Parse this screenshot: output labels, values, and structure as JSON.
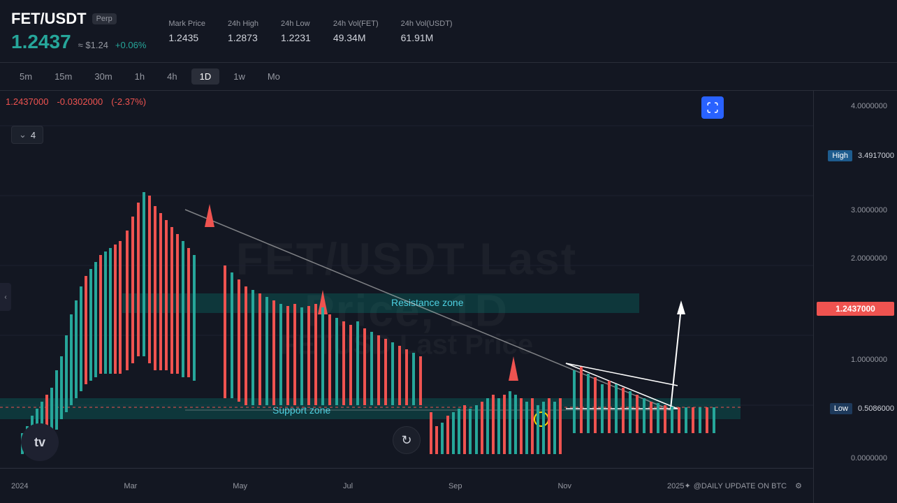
{
  "header": {
    "pair_symbol": "FET/USDT",
    "pair_type": "Perp",
    "price": "1.2437",
    "price_usd": "≈ $1.24",
    "price_change": "+0.06%",
    "mark_price_label": "Mark Price",
    "mark_price_value": "1.2435",
    "high_label": "24h High",
    "high_value": "1.2873",
    "low_label": "24h Low",
    "low_value": "1.2231",
    "vol_fet_label": "24h Vol(FET)",
    "vol_fet_value": "49.34M",
    "vol_usdt_label": "24h Vol(USDT)",
    "vol_usdt_value": "61.91M"
  },
  "timeframes": [
    "5m",
    "15m",
    "30m",
    "1h",
    "4h",
    "1D",
    "1w",
    "Mo"
  ],
  "active_timeframe": "1D",
  "chart": {
    "current_price": "1.2437000",
    "price_change": "-0.0302000",
    "price_change_pct": "(-2.37%)",
    "layer_count": "4",
    "resistance_label": "Resistance zone",
    "support_label": "Support zone",
    "watermark_line1": "FET/USDT Last Price, 1D",
    "watermark_line2": "FETUSD Last Price",
    "current_price_badge": "1.2437000",
    "high_badge_label": "High",
    "high_badge_value": "3.4917000",
    "low_badge_label": "Low",
    "low_badge_value": "0.5086000",
    "price_levels": [
      "4.0000000",
      "3.0000000",
      "2.0000000",
      "1.0000000",
      "0.0000000"
    ]
  },
  "time_labels": [
    "2024",
    "Mar",
    "May",
    "Jul",
    "Sep",
    "Nov",
    "2025"
  ],
  "social_tag": "@DAILY UPDATE ON BTC",
  "fullscreen_icon": "⛶",
  "collapse_icon": "‹",
  "reset_icon": "↺",
  "tv_logo": "tv"
}
